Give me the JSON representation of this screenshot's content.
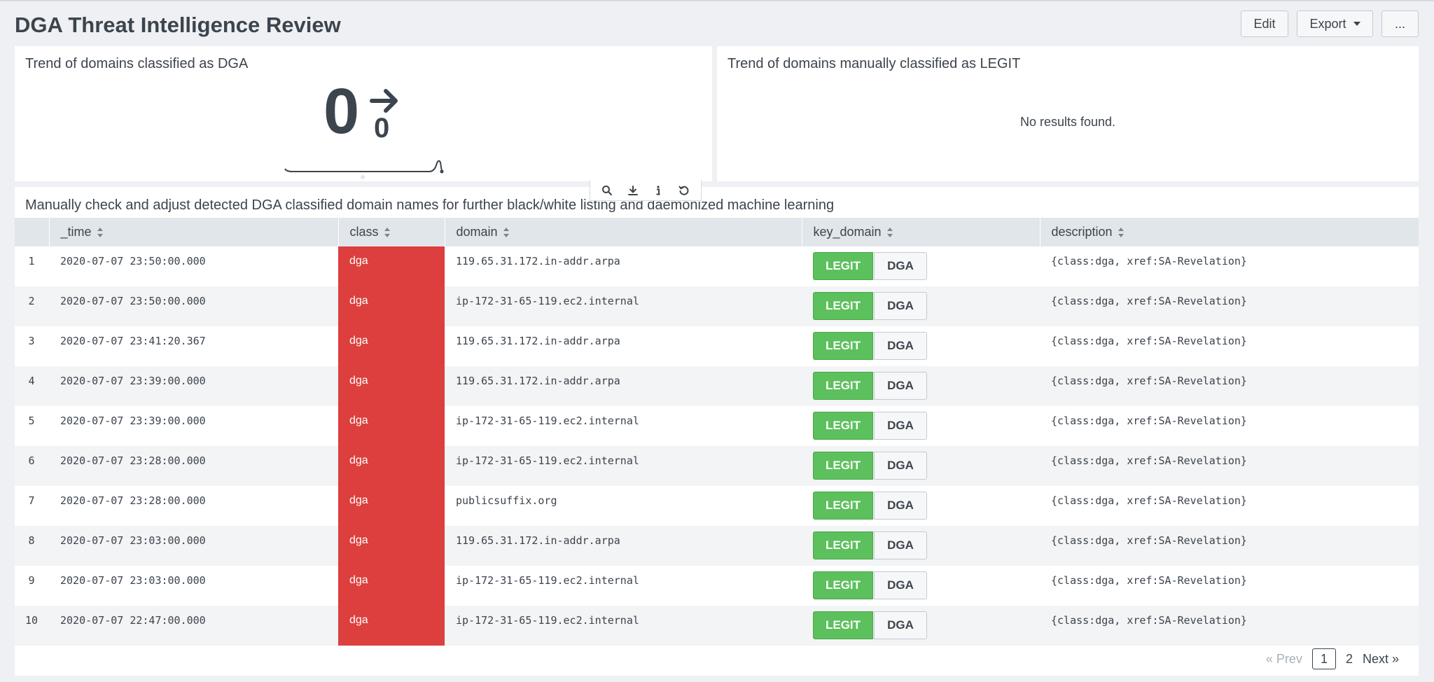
{
  "header": {
    "title": "DGA Threat Intelligence Review",
    "edit_label": "Edit",
    "export_label": "Export",
    "more_label": "..."
  },
  "panel_dga": {
    "title": "Trend of domains classified as DGA",
    "value": "0",
    "delta": "0",
    "trend_icon": "arrow-right-icon"
  },
  "panel_legit": {
    "title": "Trend of domains manually classified as LEGIT",
    "message": "No results found."
  },
  "toolbar": {
    "icons": [
      "search-icon",
      "download-icon",
      "info-icon",
      "refresh-icon"
    ]
  },
  "table_panel": {
    "title": "Manually check and adjust detected DGA classified domain names for further black/white listing and daemonized machine learning",
    "columns": [
      "_time",
      "class",
      "domain",
      "key_domain",
      "description"
    ],
    "legit_label": "LEGIT",
    "dga_label": "DGA",
    "rows": [
      {
        "n": "1",
        "time": "2020-07-07 23:50:00.000",
        "class": "dga",
        "domain": "119.65.31.172.in-addr.arpa",
        "description": "{class:dga, xref:SA-Revelation}"
      },
      {
        "n": "2",
        "time": "2020-07-07 23:50:00.000",
        "class": "dga",
        "domain": "ip-172-31-65-119.ec2.internal",
        "description": "{class:dga, xref:SA-Revelation}"
      },
      {
        "n": "3",
        "time": "2020-07-07 23:41:20.367",
        "class": "dga",
        "domain": "119.65.31.172.in-addr.arpa",
        "description": "{class:dga, xref:SA-Revelation}"
      },
      {
        "n": "4",
        "time": "2020-07-07 23:39:00.000",
        "class": "dga",
        "domain": "119.65.31.172.in-addr.arpa",
        "description": "{class:dga, xref:SA-Revelation}"
      },
      {
        "n": "5",
        "time": "2020-07-07 23:39:00.000",
        "class": "dga",
        "domain": "ip-172-31-65-119.ec2.internal",
        "description": "{class:dga, xref:SA-Revelation}"
      },
      {
        "n": "6",
        "time": "2020-07-07 23:28:00.000",
        "class": "dga",
        "domain": "ip-172-31-65-119.ec2.internal",
        "description": "{class:dga, xref:SA-Revelation}"
      },
      {
        "n": "7",
        "time": "2020-07-07 23:28:00.000",
        "class": "dga",
        "domain": "publicsuffix.org",
        "description": "{class:dga, xref:SA-Revelation}"
      },
      {
        "n": "8",
        "time": "2020-07-07 23:03:00.000",
        "class": "dga",
        "domain": "119.65.31.172.in-addr.arpa",
        "description": "{class:dga, xref:SA-Revelation}"
      },
      {
        "n": "9",
        "time": "2020-07-07 23:03:00.000",
        "class": "dga",
        "domain": "ip-172-31-65-119.ec2.internal",
        "description": "{class:dga, xref:SA-Revelation}"
      },
      {
        "n": "10",
        "time": "2020-07-07 22:47:00.000",
        "class": "dga",
        "domain": "ip-172-31-65-119.ec2.internal",
        "description": "{class:dga, xref:SA-Revelation}"
      }
    ]
  },
  "pagination": {
    "prev_label": "« Prev",
    "pages": [
      "1",
      "2"
    ],
    "current_page": "1",
    "next_label": "Next »"
  },
  "colors": {
    "dga_cell": "#dc3f3d",
    "legit_button": "#5cc05c",
    "header_bg": "#e1e6eb"
  }
}
